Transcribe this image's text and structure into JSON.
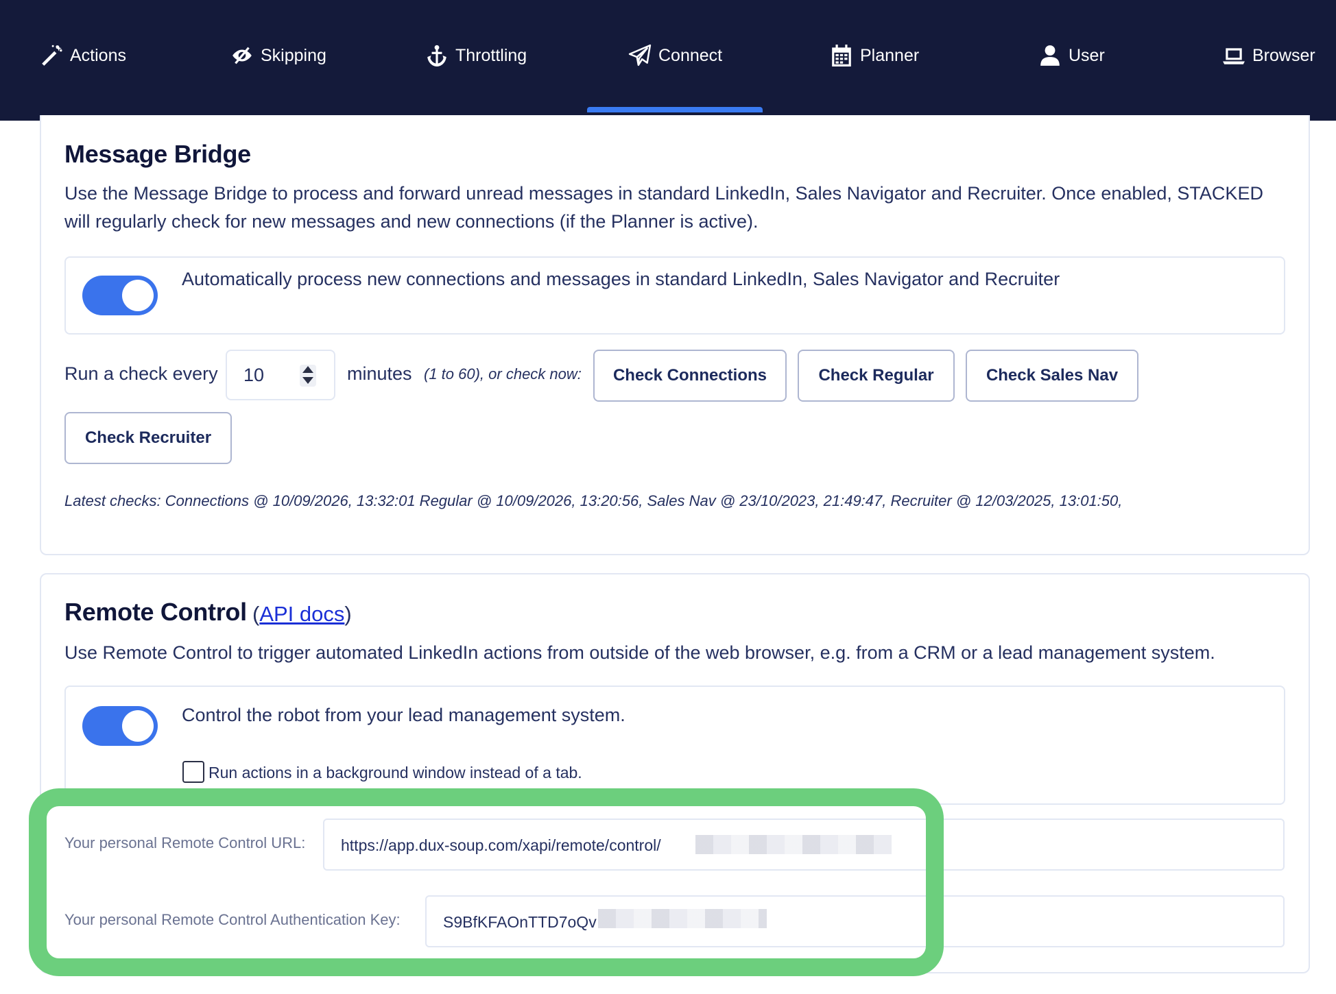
{
  "nav": {
    "items": [
      {
        "label": "Actions",
        "icon": "magic-wand-icon"
      },
      {
        "label": "Skipping",
        "icon": "eye-slash-icon"
      },
      {
        "label": "Throttling",
        "icon": "anchor-icon"
      },
      {
        "label": "Connect",
        "icon": "paper-plane-icon",
        "active": true
      },
      {
        "label": "Planner",
        "icon": "calendar-icon"
      },
      {
        "label": "User",
        "icon": "user-icon"
      },
      {
        "label": "Browser",
        "icon": "laptop-icon"
      }
    ]
  },
  "message_bridge": {
    "title": "Message Bridge",
    "description": "Use the Message Bridge to process and forward unread messages in standard LinkedIn, Sales Navigator and Recruiter. Once enabled, STACKED will regularly check for new messages and new connections (if the Planner is active).",
    "toggle_label": "Automatically process new connections and messages in standard LinkedIn, Sales Navigator and Recruiter",
    "toggle_on": true,
    "run_check_label": "Run a check every",
    "interval_value": "10",
    "minutes_label": "minutes",
    "range_note": "(1 to 60), or check now:",
    "buttons": {
      "check_connections": "Check Connections",
      "check_regular": "Check Regular",
      "check_sales_nav": "Check Sales Nav",
      "check_recruiter": "Check Recruiter"
    },
    "latest_checks": "Latest checks: Connections @ 10/09/2026, 13:32:01 Regular @ 10/09/2026, 13:20:56, Sales Nav @ 23/10/2023, 21:49:47, Recruiter @ 12/03/2025, 13:01:50,"
  },
  "remote_control": {
    "title": "Remote Control",
    "api_open": "(",
    "api_link": "API docs",
    "api_close": ")",
    "description": "Use Remote Control to trigger automated LinkedIn actions from outside of the web browser, e.g. from a CRM or a lead management system.",
    "toggle_label": "Control the robot from your lead management system.",
    "toggle_on": true,
    "background_checkbox_label": "Run actions in a background window instead of a tab.",
    "background_checked": false,
    "url_label": "Your personal Remote Control URL:",
    "url_value": "https://app.dux-soup.com/xapi/remote/control/",
    "key_label": "Your personal Remote Control Authentication Key:",
    "key_value": "S9BfKFAOnTTD7oQv"
  },
  "colors": {
    "nav_bg": "#141a3a",
    "accent": "#3a73ec",
    "highlight": "#6ccf7d"
  }
}
